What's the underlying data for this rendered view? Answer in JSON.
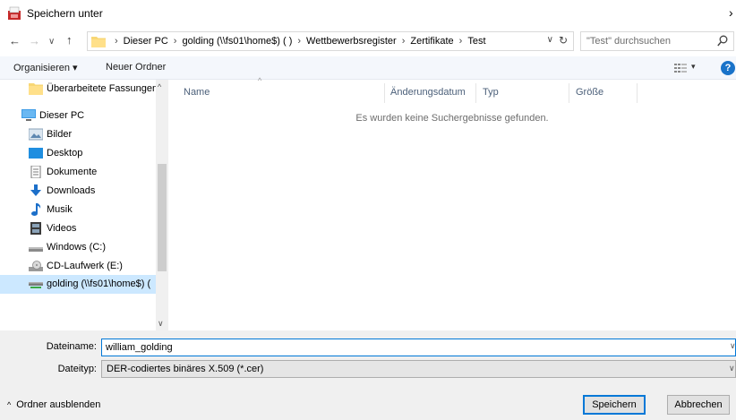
{
  "window": {
    "title": "Speichern unter",
    "close_glyph": "›"
  },
  "address": {
    "crumbs": [
      "Dieser PC",
      "golding  (\\\\fs01\\home$) (   )",
      "Wettbewerbsregister",
      "Zertifikate",
      "Test"
    ],
    "separator": "›",
    "dropdown_glyph": "∨",
    "refresh_glyph": "↻"
  },
  "search": {
    "placeholder": "\"Test\" durchsuchen"
  },
  "toolbar": {
    "organize_label": "Organisieren ▾",
    "newfolder_label": "Neuer Ordner",
    "view_caret": "▾",
    "help_label": "?"
  },
  "navpane": {
    "items": [
      {
        "label": "Überarbeitete Fassungen r",
        "icon": "folder-icon"
      },
      {
        "label": "Dieser PC",
        "icon": "computer-icon"
      },
      {
        "label": "Bilder",
        "icon": "pictures-icon"
      },
      {
        "label": "Desktop",
        "icon": "desktop-icon"
      },
      {
        "label": "Dokumente",
        "icon": "documents-icon"
      },
      {
        "label": "Downloads",
        "icon": "downloads-icon"
      },
      {
        "label": "Musik",
        "icon": "music-icon"
      },
      {
        "label": "Videos",
        "icon": "videos-icon"
      },
      {
        "label": "Windows (C:)",
        "icon": "drive-icon"
      },
      {
        "label": "CD-Laufwerk (E:)",
        "icon": "cd-drive-icon"
      },
      {
        "label": "golding  (\\\\fs01\\home$) (",
        "icon": "network-drive-icon"
      }
    ],
    "selected_label": "golding  (\\\\fs01\\home$) ("
  },
  "filelist": {
    "columns": [
      "Name",
      "Änderungsdatum",
      "Typ",
      "Größe"
    ],
    "empty_message": "Es wurden keine Suchergebnisse gefunden."
  },
  "form": {
    "filename_label": "Dateiname:",
    "filename_value": "william_golding",
    "filetype_label": "Dateityp:",
    "filetype_value": "DER-codiertes binäres X.509 (*.cer)",
    "hide_folders_label": "Ordner ausblenden",
    "save_label": "Speichern",
    "cancel_label": "Abbrechen"
  },
  "colors": {
    "accent": "#0078d7",
    "selection": "#cce8ff",
    "toolbar_bg": "#f4f7fc",
    "form_bg": "#f0f0f0"
  }
}
